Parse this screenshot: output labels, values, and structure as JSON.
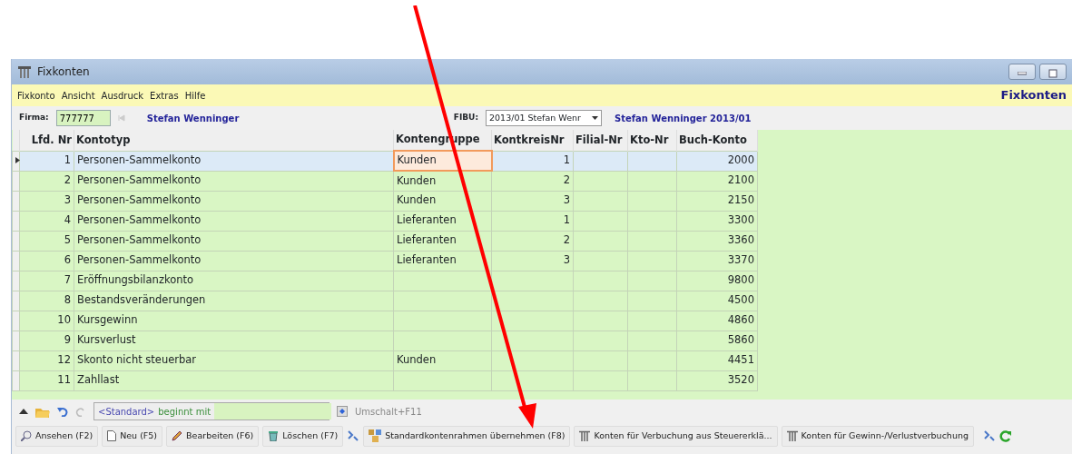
{
  "window": {
    "title": "Fixkonten"
  },
  "menu": [
    {
      "label": "Fixkonto"
    },
    {
      "label": "Ansicht"
    },
    {
      "label": "Ausdruck"
    },
    {
      "label": "Extras"
    },
    {
      "label": "Hilfe"
    }
  ],
  "menu_title": "Fixkonten",
  "firma": {
    "label": "Firma:",
    "value": "777777",
    "name": "Stefan Wenninger"
  },
  "fibu": {
    "label": "FIBU:",
    "value": "2013/01 Stefan Wenr",
    "name": "Stefan Wenninger 2013/01"
  },
  "table": {
    "columns": [
      "Lfd. Nr",
      "Kontotyp",
      "Kontengruppe",
      "KontkreisNr",
      "Filial-Nr",
      "Kto-Nr",
      "Buch-Konto"
    ],
    "rows": [
      {
        "selected": true,
        "cells": [
          "1",
          "Personen-Sammelkonto",
          "Kunden",
          "1",
          "",
          "",
          "2000"
        ]
      },
      {
        "selected": false,
        "cells": [
          "2",
          "Personen-Sammelkonto",
          "Kunden",
          "2",
          "",
          "",
          "2100"
        ]
      },
      {
        "selected": false,
        "cells": [
          "3",
          "Personen-Sammelkonto",
          "Kunden",
          "3",
          "",
          "",
          "2150"
        ]
      },
      {
        "selected": false,
        "cells": [
          "4",
          "Personen-Sammelkonto",
          "Lieferanten",
          "1",
          "",
          "",
          "3300"
        ]
      },
      {
        "selected": false,
        "cells": [
          "5",
          "Personen-Sammelkonto",
          "Lieferanten",
          "2",
          "",
          "",
          "3360"
        ]
      },
      {
        "selected": false,
        "cells": [
          "6",
          "Personen-Sammelkonto",
          "Lieferanten",
          "3",
          "",
          "",
          "3370"
        ]
      },
      {
        "selected": false,
        "cells": [
          "7",
          "Eröffnungsbilanzkonto",
          "",
          "",
          "",
          "",
          "9800"
        ]
      },
      {
        "selected": false,
        "cells": [
          "8",
          "Bestandsveränderungen",
          "",
          "",
          "",
          "",
          "4500"
        ]
      },
      {
        "selected": false,
        "cells": [
          "10",
          "Kursgewinn",
          "",
          "",
          "",
          "",
          "4860"
        ]
      },
      {
        "selected": false,
        "cells": [
          "9",
          "Kursverlust",
          "",
          "",
          "",
          "",
          "5860"
        ]
      },
      {
        "selected": false,
        "cells": [
          "12",
          "Skonto nicht steuerbar",
          "Kunden",
          "",
          "",
          "",
          "4451"
        ]
      },
      {
        "selected": false,
        "cells": [
          "11",
          "Zahllast",
          "",
          "",
          "",
          "",
          "3520"
        ]
      }
    ]
  },
  "filter": {
    "mode": "<Standard>",
    "operator": "beginnt mit",
    "shortcut": "Umschalt+F11"
  },
  "buttons": [
    {
      "label": "Ansehen (F2)",
      "kind": "search"
    },
    {
      "label": "Neu (F5)",
      "kind": "page"
    },
    {
      "label": "Bearbeiten (F6)",
      "kind": "pencil"
    },
    {
      "label": "Löschen (F7)",
      "kind": "bin"
    },
    {
      "label": "Standardkontenrahmen übernehmen (F8)",
      "kind": "boxes"
    },
    {
      "label": "Konten für Verbuchung aus Steuererklä...",
      "kind": "tkonto"
    },
    {
      "label": "Konten für Gewinn-/Verlustverbuchung",
      "kind": "tkonto"
    }
  ]
}
